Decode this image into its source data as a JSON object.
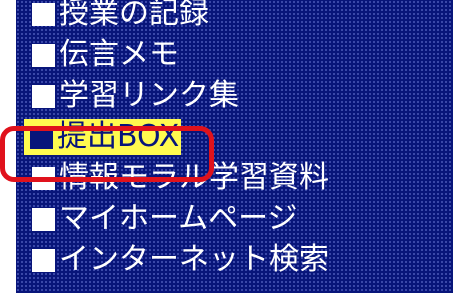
{
  "menu": {
    "items": [
      {
        "label": "授業の記録",
        "selected": false
      },
      {
        "label": "伝言メモ",
        "selected": false
      },
      {
        "label": "学習リンク集",
        "selected": false
      },
      {
        "label": "提出BOX",
        "selected": true
      },
      {
        "label": "情報モラル学習資料",
        "selected": false
      },
      {
        "label": "マイホームページ",
        "selected": false
      },
      {
        "label": "インターネット検索",
        "selected": false
      }
    ]
  },
  "colors": {
    "panel_background": "#08157a",
    "text": "#ffffff",
    "selected_background": "#fffa4f",
    "annotation_frame": "#e0121c"
  },
  "icons": {
    "bullet": "white-square-bullet-icon"
  }
}
